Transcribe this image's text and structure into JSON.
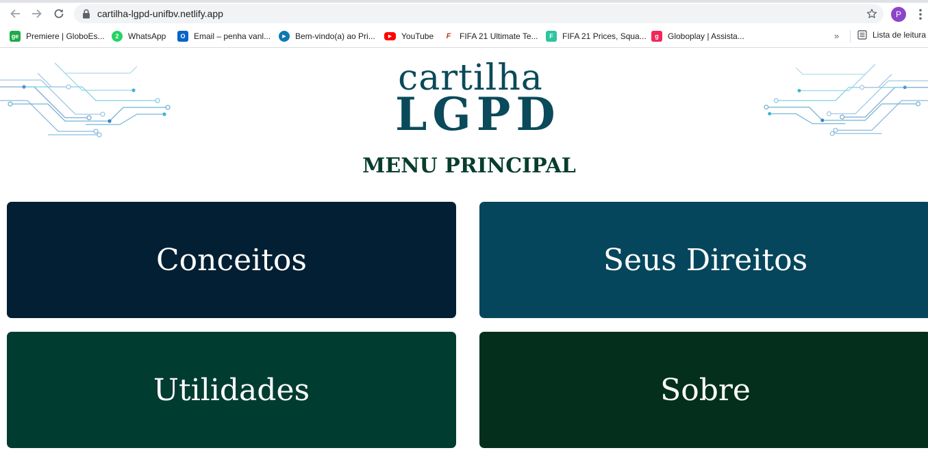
{
  "browser": {
    "url": "cartilha-lgpd-unifbv.netlify.app",
    "profile_initial": "P",
    "bookmarks": [
      {
        "label": "Premiere | GloboEs...",
        "icon": "ge-icon",
        "color": "#1faa4a",
        "glyph": "ge"
      },
      {
        "label": "WhatsApp",
        "icon": "whatsapp-icon",
        "color": "#25d366",
        "glyph": "2"
      },
      {
        "label": "Email – penha vanl...",
        "icon": "outlook-icon",
        "color": "#0a64c8",
        "glyph": "O"
      },
      {
        "label": "Bem-vindo(a) ao Pri...",
        "icon": "prime-video-icon",
        "color": "#0f79af",
        "glyph": "▶"
      },
      {
        "label": "YouTube",
        "icon": "youtube-icon",
        "color": "#ff0000",
        "glyph": "▶"
      },
      {
        "label": "FIFA 21 Ultimate Te...",
        "icon": "futhead-icon",
        "color": "#c0392b",
        "glyph": "F"
      },
      {
        "label": "FIFA 21 Prices, Squa...",
        "icon": "futbin-icon",
        "color": "#2ec4a0",
        "glyph": "F"
      },
      {
        "label": "Globoplay | Assista...",
        "icon": "globoplay-icon",
        "color": "#f2285a",
        "glyph": "g"
      }
    ],
    "reading_list_label": "Lista de leitura"
  },
  "logo": {
    "line1": "cartilha",
    "line2": "LGPD",
    "color": "#0a4a5a"
  },
  "menu": {
    "title": "MENU PRINCIPAL",
    "tiles": [
      {
        "label": "Conceitos",
        "color": "#021f33"
      },
      {
        "label": "Seus Direitos",
        "color": "#05465c"
      },
      {
        "label": "Utilidades",
        "color": "#013c31"
      },
      {
        "label": "Sobre",
        "color": "#042f1c"
      }
    ]
  }
}
